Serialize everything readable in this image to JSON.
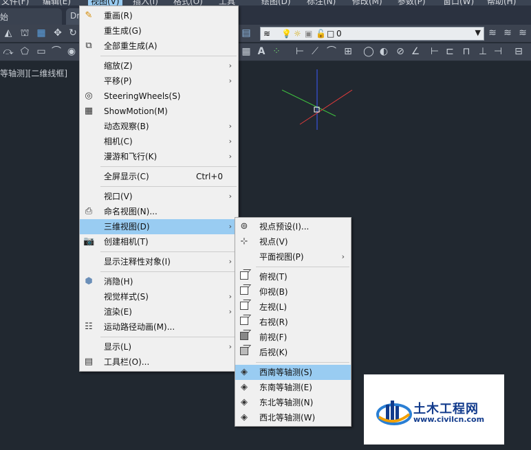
{
  "menubar": {
    "items": [
      "文件(F)",
      "编辑(E)",
      "视图(V)",
      "插入(I)",
      "格式(O)",
      "工具",
      "绘图(D)",
      "标注(N)",
      "修改(M)",
      "参数(P)",
      "窗口(W)",
      "帮助(H)"
    ]
  },
  "tabs": [
    "始",
    "Dr"
  ],
  "layer": {
    "value": "0"
  },
  "viewport": {
    "label": "等轴测][二维线框]"
  },
  "view_menu": {
    "items": [
      {
        "label": "重画(R)",
        "icon": "pencil-icon",
        "shortcut": "",
        "submenu": false
      },
      {
        "label": "重生成(G)",
        "icon": "",
        "shortcut": "",
        "submenu": false
      },
      {
        "label": "全部重生成(A)",
        "icon": "regen-all-icon",
        "shortcut": "",
        "submenu": false
      },
      {
        "label": "缩放(Z)",
        "icon": "",
        "shortcut": "",
        "submenu": true
      },
      {
        "label": "平移(P)",
        "icon": "",
        "shortcut": "",
        "submenu": true
      },
      {
        "label": "SteeringWheels(S)",
        "icon": "steering-wheel-icon",
        "shortcut": "",
        "submenu": false
      },
      {
        "label": "ShowMotion(M)",
        "icon": "showmotion-icon",
        "shortcut": "",
        "submenu": false
      },
      {
        "label": "动态观察(B)",
        "icon": "",
        "shortcut": "",
        "submenu": true
      },
      {
        "label": "相机(C)",
        "icon": "",
        "shortcut": "",
        "submenu": true
      },
      {
        "label": "漫游和飞行(K)",
        "icon": "",
        "shortcut": "",
        "submenu": true
      },
      {
        "label": "全屏显示(C)",
        "icon": "",
        "shortcut": "Ctrl+0",
        "submenu": false
      },
      {
        "label": "视口(V)",
        "icon": "",
        "shortcut": "",
        "submenu": true
      },
      {
        "label": "命名视图(N)...",
        "icon": "named-view-icon",
        "shortcut": "",
        "submenu": false
      },
      {
        "label": "三维视图(D)",
        "icon": "",
        "shortcut": "",
        "submenu": true
      },
      {
        "label": "创建相机(T)",
        "icon": "camera-icon",
        "shortcut": "",
        "submenu": false
      },
      {
        "label": "显示注释性对象(I)",
        "icon": "",
        "shortcut": "",
        "submenu": true
      },
      {
        "label": "消隐(H)",
        "icon": "hide-icon",
        "shortcut": "",
        "submenu": false
      },
      {
        "label": "视觉样式(S)",
        "icon": "",
        "shortcut": "",
        "submenu": true
      },
      {
        "label": "渲染(E)",
        "icon": "",
        "shortcut": "",
        "submenu": true
      },
      {
        "label": "运动路径动画(M)...",
        "icon": "motion-path-icon",
        "shortcut": "",
        "submenu": false
      },
      {
        "label": "显示(L)",
        "icon": "",
        "shortcut": "",
        "submenu": true
      },
      {
        "label": "工具栏(O)...",
        "icon": "toolbar-icon",
        "shortcut": "",
        "submenu": false
      }
    ]
  },
  "view3d_menu": {
    "items": [
      {
        "label": "视点预设(I)...",
        "submenu": false
      },
      {
        "label": "视点(V)",
        "submenu": false
      },
      {
        "label": "平面视图(P)",
        "submenu": true
      },
      {
        "label": "俯视(T)",
        "submenu": false
      },
      {
        "label": "仰视(B)",
        "submenu": false
      },
      {
        "label": "左视(L)",
        "submenu": false
      },
      {
        "label": "右视(R)",
        "submenu": false
      },
      {
        "label": "前视(F)",
        "submenu": false
      },
      {
        "label": "后视(K)",
        "submenu": false
      },
      {
        "label": "西南等轴测(S)",
        "submenu": false
      },
      {
        "label": "东南等轴测(E)",
        "submenu": false
      },
      {
        "label": "东北等轴测(N)",
        "submenu": false
      },
      {
        "label": "西北等轴测(W)",
        "submenu": false
      }
    ]
  },
  "watermark": {
    "title": "土木工程网",
    "url": "www.civilcn.com"
  },
  "colors": {
    "highlight": "#99ccf2",
    "canvas": "#212830",
    "axis_x": "#e23b3b",
    "axis_y": "#3fc03f",
    "axis_z": "#3a5cff"
  }
}
